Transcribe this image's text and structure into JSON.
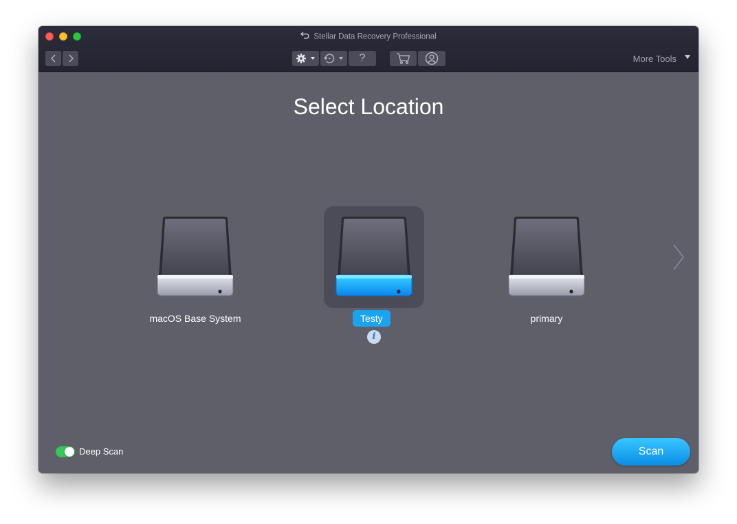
{
  "window": {
    "title": "Stellar Data Recovery Professional"
  },
  "toolbar": {
    "icons": [
      "chevron-left-icon",
      "chevron-right-icon",
      "gear-icon",
      "history-icon",
      "question-icon",
      "cart-icon",
      "user-icon"
    ],
    "help_label": "?",
    "more_tools_label": "More Tools"
  },
  "main": {
    "heading": "Select Location",
    "drives": [
      {
        "label": "macOS Base System",
        "selected": false
      },
      {
        "label": "Testy",
        "selected": true
      },
      {
        "label": "primary",
        "selected": false
      }
    ],
    "info_label": "i"
  },
  "footer": {
    "deep_scan_label": "Deep Scan",
    "deep_scan_enabled": true,
    "scan_label": "Scan"
  },
  "colors": {
    "accent": "#1aa4f0",
    "toggle_on": "#34c759",
    "background": "#5f5f6a",
    "titlebar": "#2a2a37"
  }
}
